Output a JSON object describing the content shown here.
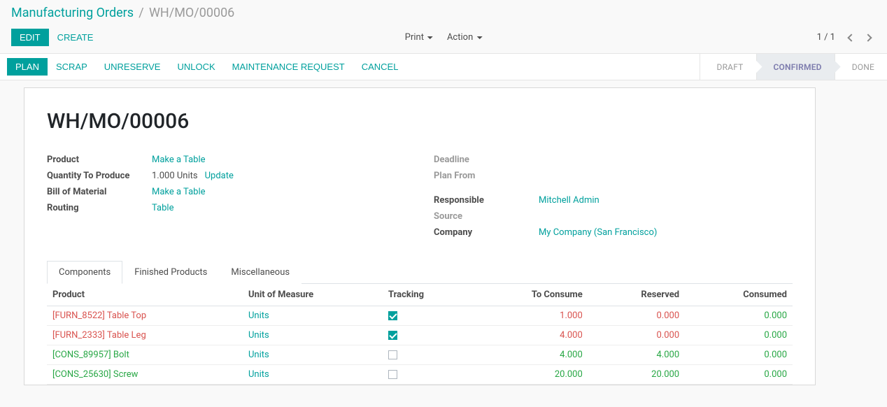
{
  "breadcrumb": {
    "parent": "Manufacturing Orders",
    "sep": "/",
    "current": "WH/MO/00006"
  },
  "top": {
    "edit": "EDIT",
    "create": "CREATE",
    "print": "Print",
    "action": "Action",
    "pager": "1 / 1"
  },
  "statusbar": {
    "plan": "PLAN",
    "scrap": "SCRAP",
    "unreserve": "UNRESERVE",
    "unlock": "UNLOCK",
    "maintenance": "MAINTENANCE REQUEST",
    "cancel": "CANCEL",
    "steps": {
      "draft": "DRAFT",
      "confirmed": "CONFIRMED",
      "done": "DONE"
    }
  },
  "record": {
    "title": "WH/MO/00006",
    "labels": {
      "product": "Product",
      "qty": "Quantity To Produce",
      "bom": "Bill of Material",
      "routing": "Routing",
      "deadline": "Deadline",
      "planfrom": "Plan From",
      "responsible": "Responsible",
      "source": "Source",
      "company": "Company"
    },
    "values": {
      "product": "Make a Table",
      "qty": "1.000 Units",
      "update": "Update",
      "bom": "Make a Table",
      "routing": "Table",
      "responsible": "Mitchell Admin",
      "company": "My Company (San Francisco)"
    }
  },
  "tabs": {
    "components": "Components",
    "finished": "Finished Products",
    "misc": "Miscellaneous"
  },
  "table": {
    "headers": {
      "product": "Product",
      "uom": "Unit of Measure",
      "tracking": "Tracking",
      "toconsume": "To Consume",
      "reserved": "Reserved",
      "consumed": "Consumed"
    },
    "rows": [
      {
        "product": "[FURN_8522] Table Top",
        "pclass": "prod-red",
        "uom": "Units",
        "tracking": true,
        "toconsume": "1.000",
        "tcclass": "val-red",
        "reserved": "0.000",
        "rclass": "val-red",
        "consumed": "0.000",
        "cclass": "val-green"
      },
      {
        "product": "[FURN_2333] Table Leg",
        "pclass": "prod-red",
        "uom": "Units",
        "tracking": true,
        "toconsume": "4.000",
        "tcclass": "val-red",
        "reserved": "0.000",
        "rclass": "val-red",
        "consumed": "0.000",
        "cclass": "val-green"
      },
      {
        "product": "[CONS_89957] Bolt",
        "pclass": "prod-green",
        "uom": "Units",
        "tracking": false,
        "toconsume": "4.000",
        "tcclass": "val-green",
        "reserved": "4.000",
        "rclass": "val-green",
        "consumed": "0.000",
        "cclass": "val-green"
      },
      {
        "product": "[CONS_25630] Screw",
        "pclass": "prod-green",
        "uom": "Units",
        "tracking": false,
        "toconsume": "20.000",
        "tcclass": "val-green",
        "reserved": "20.000",
        "rclass": "val-green",
        "consumed": "0.000",
        "cclass": "val-green"
      }
    ]
  }
}
